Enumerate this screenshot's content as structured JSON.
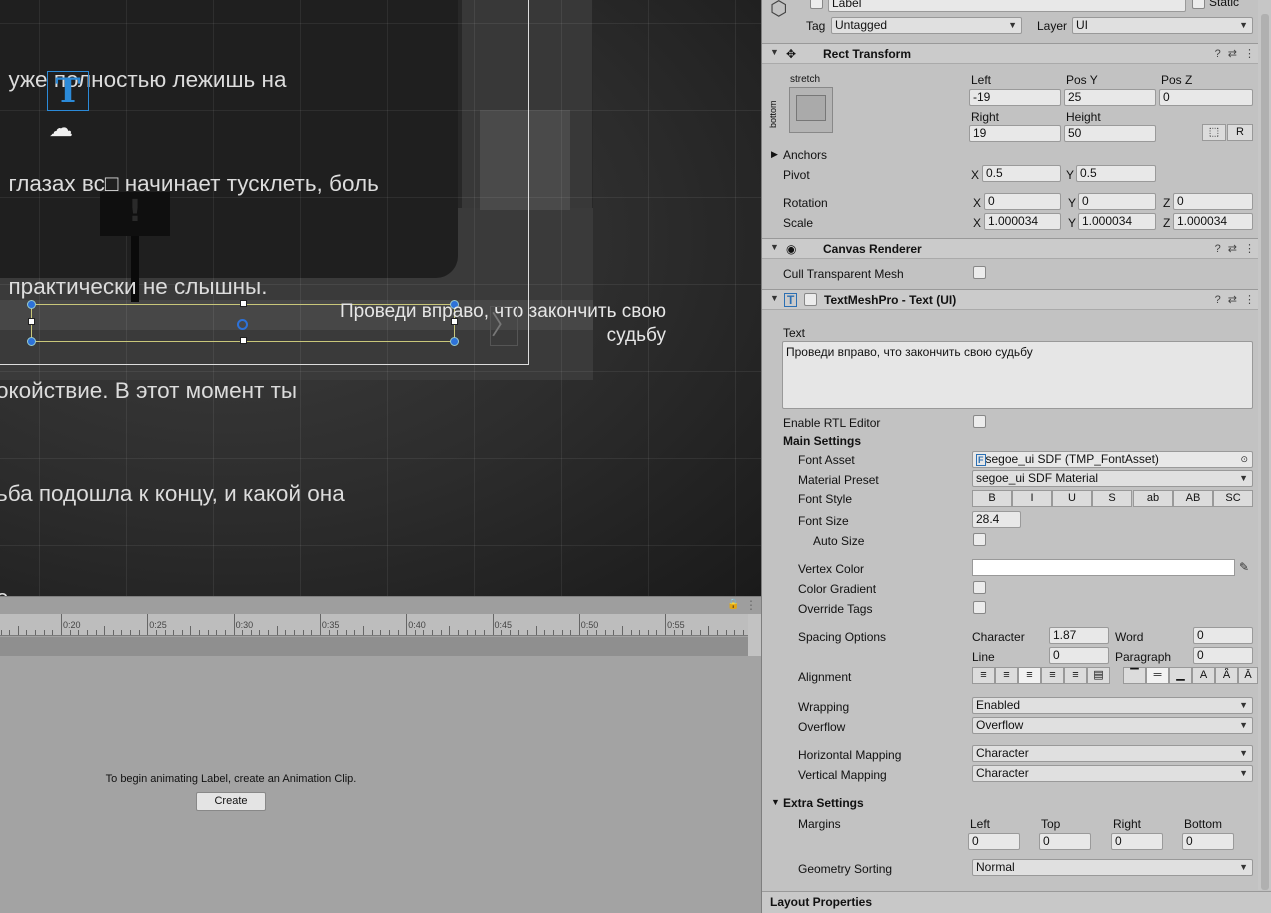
{
  "scene": {
    "story_lines": [
      "  уже полностью лежишь на",
      "  глазах вс□ начинает тусклеть, боль",
      "  практически не слышны.",
      "окойствие. В этот момент ты",
      "ьба подошла к концу, и какой она",
      "е."
    ],
    "sign_glyph": "!",
    "label_text": "Проведи вправо, что закончить свою судьбу",
    "t_icon_glyph": "T",
    "camera_glyph": "☁",
    "arrow_glyph": "〉"
  },
  "animation": {
    "ruler_labels": [
      "0:20",
      "0:25",
      "0:30",
      "0:35",
      "0:40",
      "0:45",
      "0:50",
      "0:55"
    ],
    "message": "To begin animating Label, create an Animation Clip.",
    "create_label": "Create",
    "lock_glyph": "🔒",
    "menu_glyph": "⋮"
  },
  "inspector": {
    "object_name": "Label",
    "static_label": "Static",
    "tag_label": "Tag",
    "tag_value": "Untagged",
    "layer_label": "Layer",
    "layer_value": "UI",
    "rect_transform": {
      "title": "Rect Transform",
      "stretch_label": "stretch",
      "bottom_label": "bottom",
      "headers": [
        "Left",
        "Pos Y",
        "Pos Z"
      ],
      "values": [
        "-19",
        "25",
        "0"
      ],
      "headers2": [
        "Right",
        "Height"
      ],
      "values2": [
        "19",
        "50"
      ],
      "r_button": "R",
      "anchors_label": "Anchors",
      "pivot_label": "Pivot",
      "pivot_x": "0.5",
      "pivot_y": "0.5",
      "rotation_label": "Rotation",
      "rotation": [
        "0",
        "0",
        "0"
      ],
      "scale_label": "Scale",
      "scale": [
        "1.000034",
        "1.000034",
        "1.000034"
      ],
      "axes": [
        "X",
        "Y",
        "Z"
      ]
    },
    "canvas_renderer": {
      "title": "Canvas Renderer",
      "cull_label": "Cull Transparent Mesh"
    },
    "tmp": {
      "title": "TextMeshPro - Text (UI)",
      "text_label": "Text",
      "text_value": "Проведи вправо, что закончить свою судьбу",
      "rtl_label": "Enable RTL Editor",
      "main_settings": "Main Settings",
      "font_asset_label": "Font Asset",
      "font_asset_value": "segoe_ui SDF (TMP_FontAsset)",
      "material_label": "Material Preset",
      "material_value": "segoe_ui SDF Material",
      "font_style_label": "Font Style",
      "font_styles": [
        "B",
        "I",
        "U",
        "S",
        "ab",
        "AB",
        "SC"
      ],
      "font_size_label": "Font Size",
      "font_size_value": "28.4",
      "auto_size_label": "Auto Size",
      "vertex_color_label": "Vertex Color",
      "vertex_color": "#ffffff",
      "color_gradient_label": "Color Gradient",
      "override_tags_label": "Override Tags",
      "spacing_label": "Spacing Options",
      "character_label": "Character",
      "character_value": "1.87",
      "word_label": "Word",
      "word_value": "0",
      "line_label": "Line",
      "line_value": "0",
      "paragraph_label": "Paragraph",
      "paragraph_value": "0",
      "alignment_label": "Alignment",
      "wrapping_label": "Wrapping",
      "wrapping_value": "Enabled",
      "overflow_label": "Overflow",
      "overflow_value": "Overflow",
      "hmap_label": "Horizontal Mapping",
      "hmap_value": "Character",
      "vmap_label": "Vertical Mapping",
      "vmap_value": "Character",
      "extra_settings": "Extra Settings",
      "margins_label": "Margins",
      "margin_headers": [
        "Left",
        "Top",
        "Right",
        "Bottom"
      ],
      "margin_values": [
        "0",
        "0",
        "0",
        "0"
      ],
      "geometry_label": "Geometry Sorting",
      "geometry_value": "Normal"
    },
    "layout_properties": "Layout Properties"
  }
}
